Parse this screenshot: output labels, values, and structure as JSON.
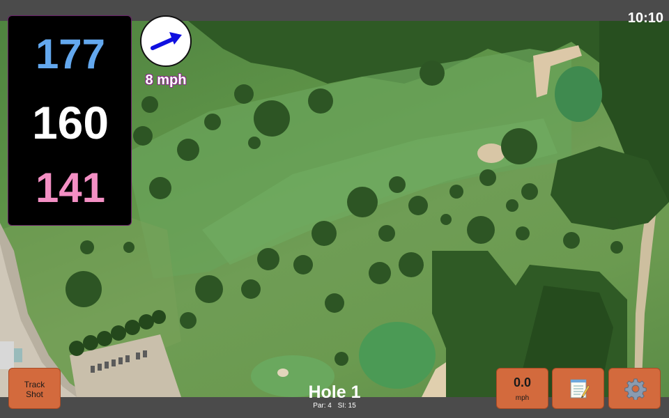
{
  "status": {
    "time": "10:10"
  },
  "distances": {
    "back": "177",
    "middle": "160",
    "front": "141"
  },
  "wind": {
    "speed": "8 mph",
    "icon": "wind-arrow-icon"
  },
  "hole": {
    "title": "Hole 1",
    "par": "Par: 4",
    "si": "SI: 15"
  },
  "buttons": {
    "track_shot": [
      "Track",
      "Shot"
    ],
    "speed_value": "0.0",
    "speed_unit": "mph",
    "notes_icon": "notepad-icon",
    "settings_icon": "gear-icon"
  },
  "colors": {
    "back_distance": "#63a8ee",
    "middle_distance": "#ffffff",
    "front_distance": "#f38fc4",
    "button": "#d36a3d",
    "bar": "#4b4b4b"
  }
}
